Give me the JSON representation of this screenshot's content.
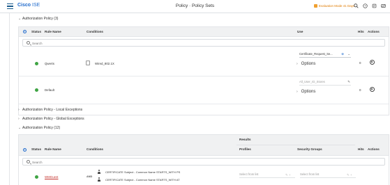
{
  "header": {
    "logo_cisco": "Cisco",
    "logo_ise": "ISE",
    "title": "Policy · Policy Sets",
    "eval_text": "Evaluation Mode 41 Days",
    "icons": [
      "search-icon",
      "help-icon",
      "notifications-icon",
      "dashboard-icon",
      "settings-icon"
    ]
  },
  "authz_policy": {
    "title": "Authorization Policy (3)",
    "columns": {
      "status": "Status",
      "rule_name": "Rule Name",
      "conditions": "Conditions",
      "use": "Use",
      "hits": "Hits",
      "actions": "Actions"
    },
    "search_placeholder": "Search",
    "rows": [
      {
        "status": "enabled",
        "rule_name": "Qwerts",
        "condition": "Wired_802.1X",
        "use_value": "Certificate_Request_Se...",
        "options_label": "Options",
        "hits": "0"
      },
      {
        "status": "enabled",
        "rule_name": "Default",
        "condition": "",
        "use_value": "All_User_ID_Stores",
        "options_label": "Options",
        "hits": "0"
      }
    ]
  },
  "local_exceptions": {
    "title": "Authorization Policy - Local Exceptions"
  },
  "global_exceptions": {
    "title": "Authorization Policy - Global Exceptions"
  },
  "authz_policy_2": {
    "title": "Authorization Policy (12)",
    "results_header": "Results",
    "columns": {
      "status": "Status",
      "rule_name": "Rule Name",
      "conditions": "Conditions",
      "profiles": "Profiles",
      "security_groups": "Security Groups",
      "hits": "Hits",
      "actions": "Actions"
    },
    "search_placeholder": "Search",
    "rows": [
      {
        "status": "enabled",
        "rule_name": "WMGuest",
        "operator": "AND",
        "conditions": [
          "CERTIFICATE Subject - Common Name STARTS_WITH PS",
          "CERTIFICATE Subject - Common Name STARTS_WITH AT"
        ],
        "profiles_placeholder": "Select from list",
        "security_groups_placeholder": "Select from list"
      }
    ]
  },
  "colors": {
    "accent": "#1d69cc",
    "status_green": "#3fa444",
    "warning": "#e07b00"
  }
}
